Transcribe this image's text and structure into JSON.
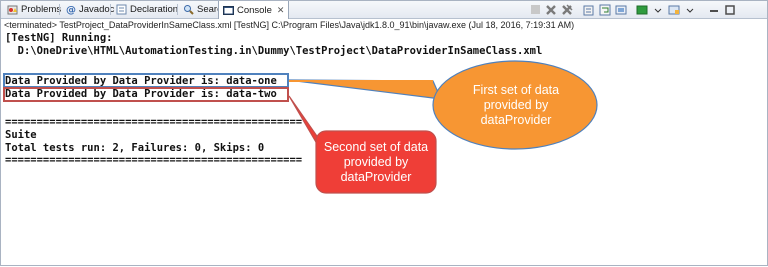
{
  "tabs": [
    {
      "label": "Problems",
      "icon": "problems-icon"
    },
    {
      "label": "Javadoc",
      "icon": "javadoc-icon"
    },
    {
      "label": "Declaration",
      "icon": "declaration-icon"
    },
    {
      "label": "Search",
      "icon": "search-icon"
    },
    {
      "label": "Console",
      "icon": "console-icon",
      "active": true
    }
  ],
  "console_status": "<terminated> TestProject_DataProviderInSameClass.xml [TestNG] C:\\Program Files\\Java\\jdk1.8.0_91\\bin\\javaw.exe (Jul 18, 2016, 7:19:31 AM)",
  "console_lines": [
    "[TestNG] Running:",
    "  D:\\OneDrive\\HTML\\AutomationTesting.in\\Dummy\\TestProject\\DataProviderInSameClass.xml",
    "",
    "Data Provided by Data Provider is: data-one",
    "Data Provided by Data Provider is: data-two",
    "",
    "===============================================",
    "Suite",
    "Total tests run: 2, Failures: 0, Skips: 0",
    "==============================================="
  ],
  "callouts": {
    "first": "First set of data provided by dataProvider",
    "second": "Second set of data provided by dataProvider"
  },
  "colors": {
    "first_fill": "#f79633",
    "first_border": "#4f81bd",
    "second_fill": "#ef3e37",
    "second_border": "#c0504d",
    "highlight_one": "#4f81bd",
    "highlight_two": "#c0504d"
  },
  "toolbar_icons": [
    "terminate-icon",
    "remove-launch-icon",
    "remove-all-icon",
    "scroll-lock-icon",
    "word-wrap-icon",
    "pin-console-icon",
    "display-selected-console-icon",
    "open-console-icon",
    "minimize-icon",
    "maximize-icon"
  ]
}
